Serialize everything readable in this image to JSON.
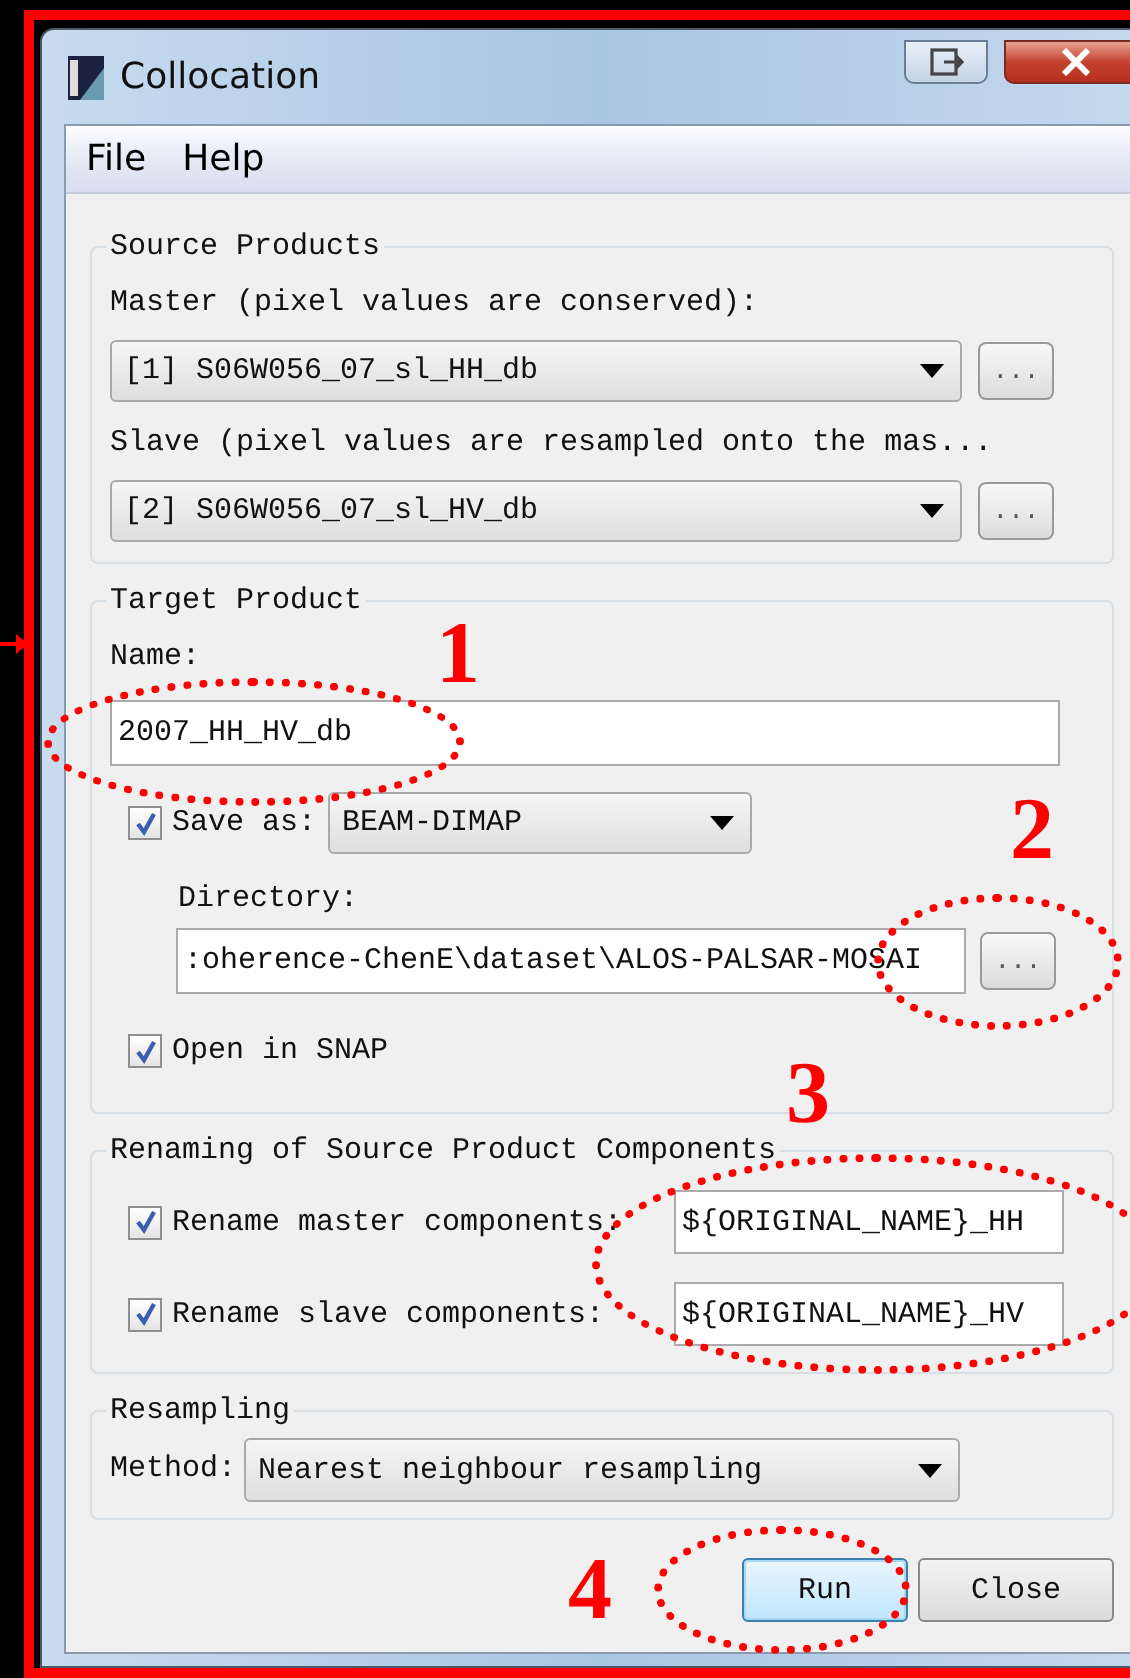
{
  "window": {
    "title": "Collocation"
  },
  "menu": [
    "File",
    "Help"
  ],
  "source_products": {
    "title": "Source Products",
    "master": {
      "label": "Master (pixel values are conserved):",
      "value": "[1] S06W056_07_sl_HH_db",
      "browse": "..."
    },
    "slave": {
      "label": "Slave (pixel values are resampled onto the mas...",
      "value": "[2] S06W056_07_sl_HV_db",
      "browse": "..."
    }
  },
  "target_product": {
    "title": "Target Product",
    "name_label": "Name:",
    "name_value": "2007_HH_HV_db",
    "save_as": {
      "label": "Save as:",
      "checked": true,
      "format": "BEAM-DIMAP"
    },
    "directory_label": "Directory:",
    "directory_value": ":oherence-ChenE\\dataset\\ALOS-PALSAR-MOSAI",
    "browse": "...",
    "open_in_snap": {
      "label": "Open in SNAP",
      "checked": true
    }
  },
  "renaming": {
    "title": "Renaming of Source Product Components",
    "rows": [
      {
        "label": "Rename master components:",
        "checked": true,
        "value": "${ORIGINAL_NAME}_HH"
      },
      {
        "label": "Rename slave components:",
        "checked": true,
        "value": "${ORIGINAL_NAME}_HV"
      }
    ]
  },
  "resampling": {
    "title": "Resampling",
    "method_label": "Method:",
    "method": "Nearest neighbour resampling"
  },
  "buttons": [
    {
      "label": "Run",
      "kind": "default"
    },
    {
      "label": "Close",
      "kind": "normal"
    }
  ],
  "annotations": [
    {
      "label": "1"
    },
    {
      "label": "2"
    },
    {
      "label": "3"
    },
    {
      "label": "4"
    }
  ]
}
